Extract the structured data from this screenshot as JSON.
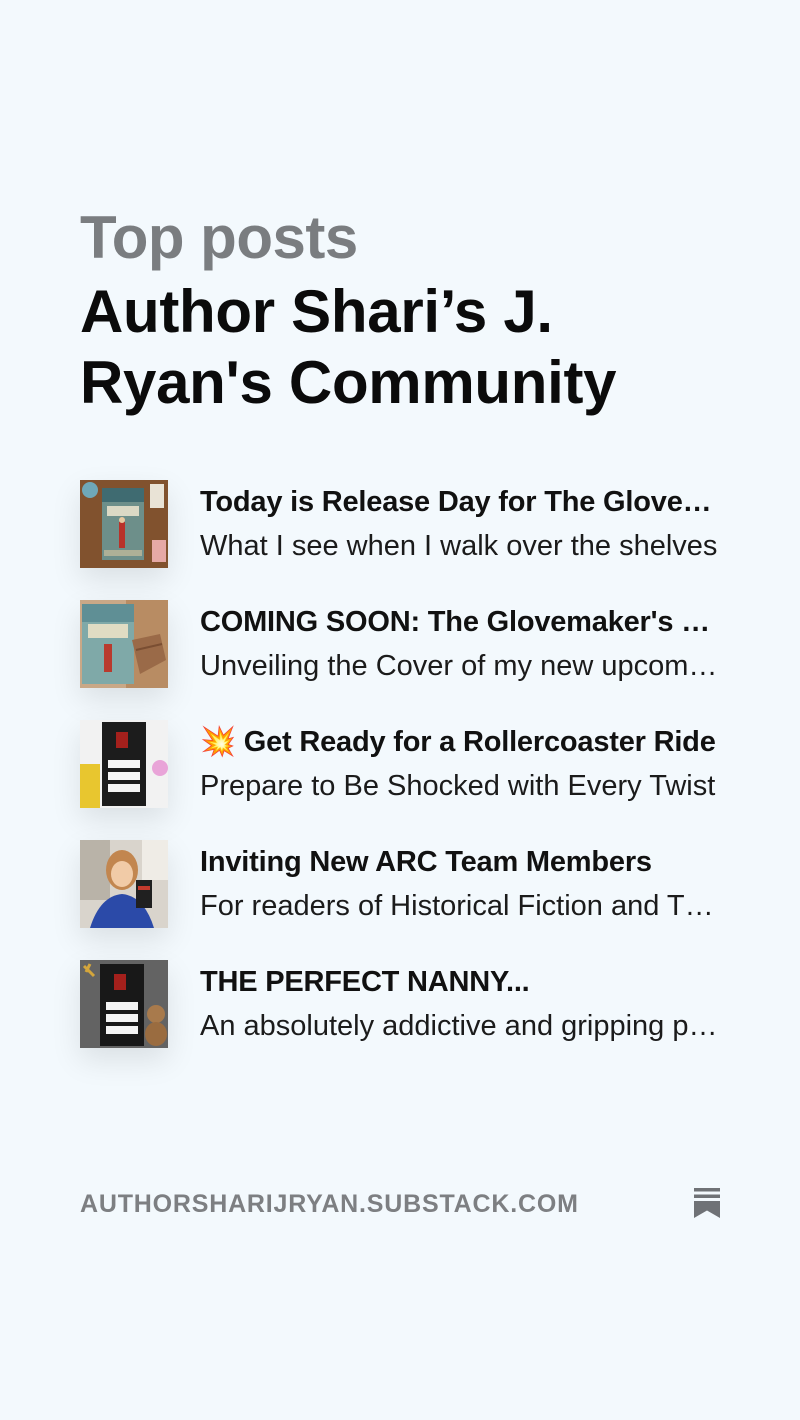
{
  "header": {
    "kicker": "Top posts",
    "publication": "Author Shari’s J. Ryan's Community"
  },
  "posts": [
    {
      "title": "Today is Release Day for The Glovemaker's Daughter",
      "subtitle": "What I see when I walk over the shelves",
      "thumbnail": "book-cover-glovemakers-daughter-flatlay"
    },
    {
      "title": "COMING SOON: The Glovemaker's Daughter",
      "subtitle": "Unveiling the Cover of my new upcoming novel",
      "thumbnail": "book-cover-glovemakers-daughter-hand"
    },
    {
      "title": "💥 Get Ready for a Rollercoaster Ride",
      "subtitle": "Prepare to Be Shocked with Every Twist",
      "thumbnail": "book-cover-perfect-nanny-flatlay"
    },
    {
      "title": "Inviting New ARC Team Members",
      "subtitle": "For readers of Historical Fiction and Thrillers",
      "thumbnail": "author-photo-holding-book"
    },
    {
      "title": "THE PERFECT NANNY...",
      "subtitle": "An absolutely addictive and gripping psychological thriller",
      "thumbnail": "book-cover-perfect-nanny-teddy"
    }
  ],
  "footer": {
    "domain": "AUTHORSHARIJRYAN.SUBSTACK.COM",
    "logo_icon": "substack-bookmark-icon"
  },
  "colors": {
    "background": "#f3f9fd",
    "kicker": "#7a7d80",
    "title": "#0b0b0b",
    "footer_text": "#7d7f82"
  }
}
